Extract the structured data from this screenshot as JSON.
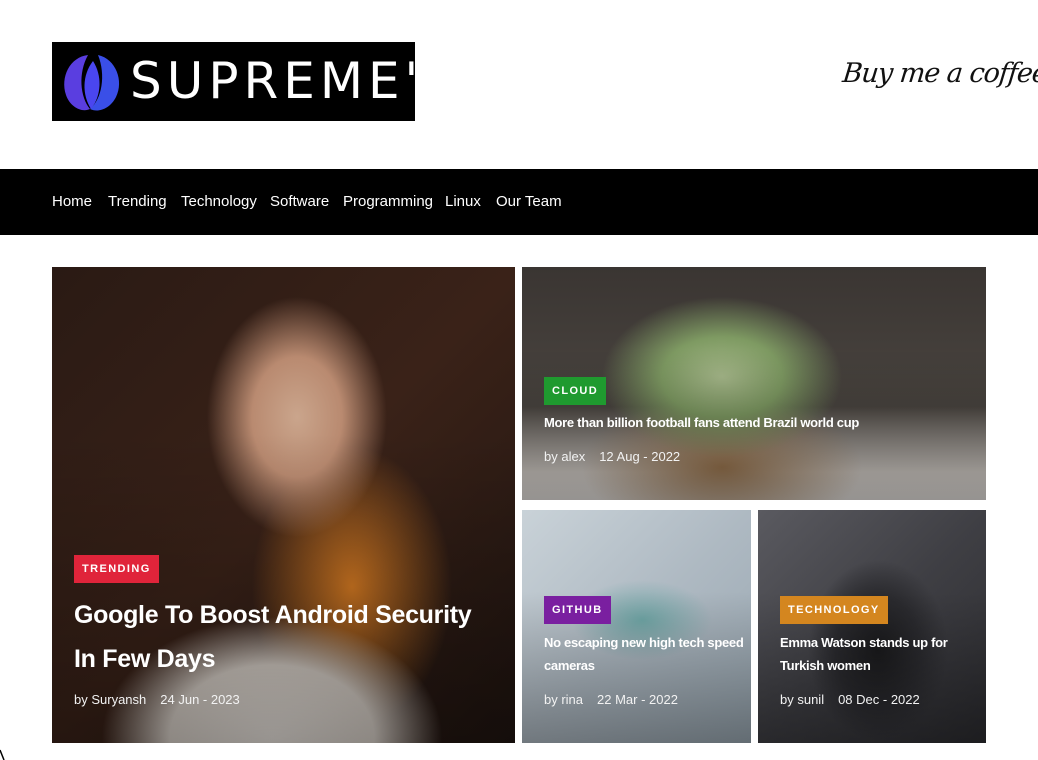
{
  "header": {
    "logo_text": "SUPREME'S",
    "coffee_label": "Buy me a coffee"
  },
  "nav": {
    "items": [
      {
        "label": "Home"
      },
      {
        "label": "Trending"
      },
      {
        "label": "Technology"
      },
      {
        "label": "Software"
      },
      {
        "label": "Programming"
      },
      {
        "label": "Linux"
      },
      {
        "label": "Our Team"
      }
    ]
  },
  "posts": [
    {
      "category": "TRENDING",
      "category_color": "#e0243a",
      "title": "Google To Boost Android Security In Few Days",
      "author": "by Suryansh",
      "date": "24 Jun - 2023"
    },
    {
      "category": "CLOUD",
      "category_color": "#1f9a2f",
      "title": "More than billion football fans attend Brazil world cup",
      "author": "by alex",
      "date": "12 Aug - 2022"
    },
    {
      "category": "GITHUB",
      "category_color": "#7a1fa0",
      "title": "No escaping new high tech speed cameras",
      "author": "by rina",
      "date": "22 Mar - 2022"
    },
    {
      "category": "TECHNOLOGY",
      "category_color": "#d4861f",
      "title": "Emma Watson stands up for Turkish women",
      "author": "by sunil",
      "date": "08 Dec - 2022"
    }
  ]
}
